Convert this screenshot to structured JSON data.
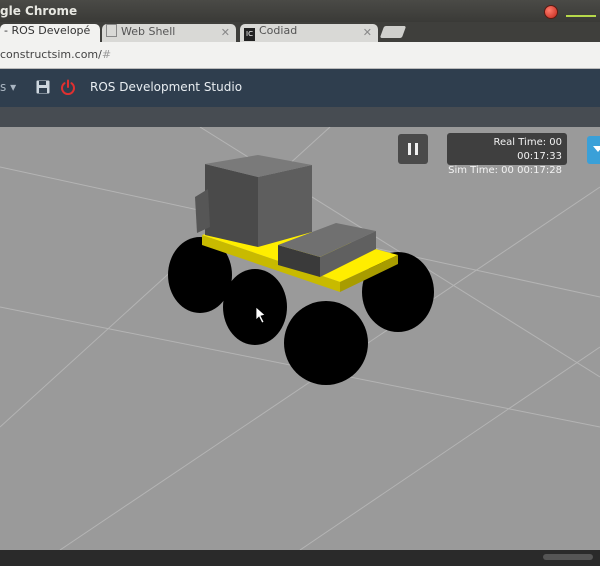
{
  "window": {
    "title": "gle Chrome"
  },
  "tabs": [
    {
      "label": "- ROS Developé",
      "icon": "page-icon",
      "active": true
    },
    {
      "label": "Web Shell",
      "icon": "document-icon",
      "active": false
    },
    {
      "label": "Codiad",
      "icon_text": "IC",
      "icon": "codiad-icon",
      "active": false
    }
  ],
  "address": {
    "url_main": "constructsim.com/",
    "url_hash": "#"
  },
  "header": {
    "menu_stub": "s ▾",
    "title": "ROS Development Studio"
  },
  "sim": {
    "real_time_label": "Real Time: 00 00:17:33",
    "sim_time_label": "Sim Time: 00 00:17:28"
  },
  "colors": {
    "header_bg": "#2f3e4e",
    "power_red": "#e03030",
    "chassis_yellow": "#ffee00",
    "ground": "#9a9a9a",
    "side_tab": "#3aa0d8"
  }
}
